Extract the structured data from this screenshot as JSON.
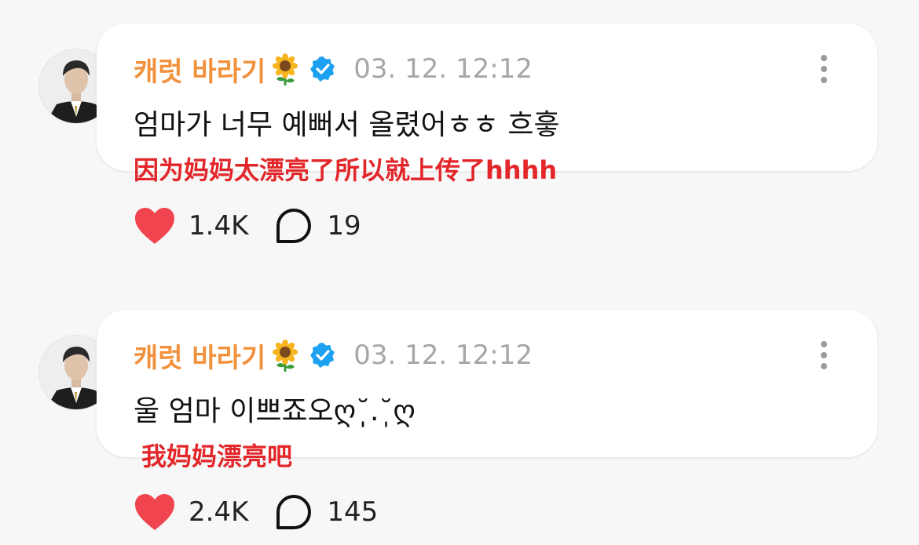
{
  "posts": [
    {
      "username": "캐럿 바라기",
      "timestamp": "03. 12. 12:12",
      "text": "엄마가 너무 예뻐서 올렸어ㅎㅎ 흐흫",
      "translation": "因为妈妈太漂亮了所以就上传了hhhh",
      "likes": "1.4K",
      "comments": "19"
    },
    {
      "username": "캐럿 바라기",
      "timestamp": "03. 12. 12:12",
      "text": "울 엄마 이쁘죠오ღ˘̩̩̩.˘̩ღ",
      "translation": "我妈妈漂亮吧",
      "likes": "2.4K",
      "comments": "145"
    }
  ],
  "icons": {
    "name_emoji": "sunflower-icon",
    "verified": "verified-badge-icon",
    "more": "more-vertical-icon",
    "like": "heart-icon",
    "comment": "comment-bubble-icon"
  },
  "colors": {
    "username": "#f2913c",
    "verified": "#1ca0f2",
    "translation": "#e2262a",
    "heart": "#f0454e",
    "timestamp": "#a6a6a6"
  }
}
